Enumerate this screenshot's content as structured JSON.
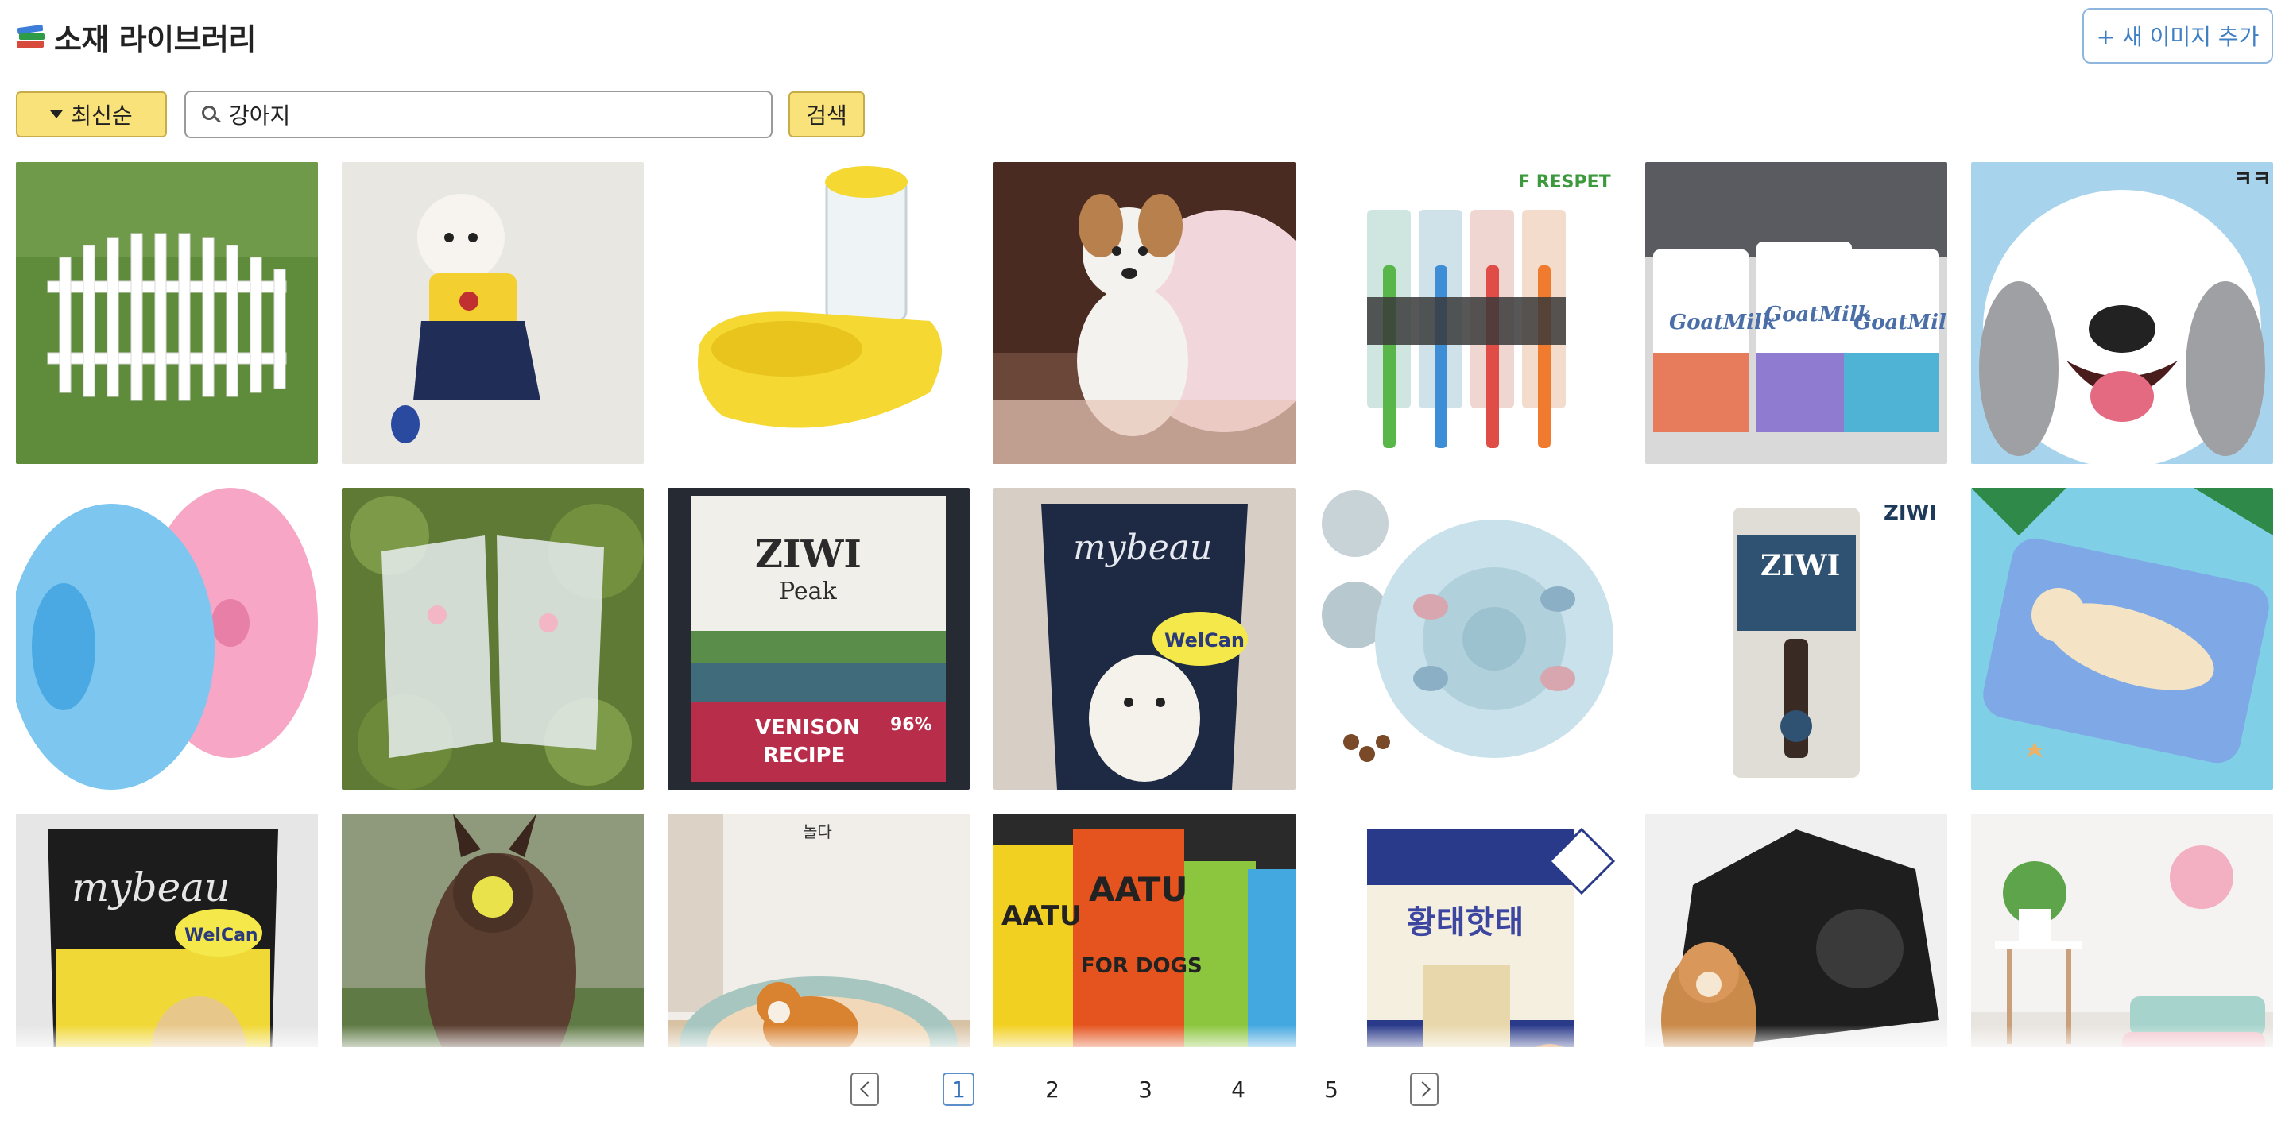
{
  "header": {
    "title": "소재 라이브러리",
    "add_button": "+ 새 이미지 추가"
  },
  "toolbar": {
    "sort_label": "최신순",
    "search_value": "강아지",
    "search_button": "검색"
  },
  "tiles": [
    {
      "name": "fence",
      "selected": false
    },
    {
      "name": "dog-dress",
      "selected": false
    },
    {
      "name": "water-dispenser",
      "selected": false
    },
    {
      "name": "puppy",
      "selected": true
    },
    {
      "name": "toothbrush-set",
      "selected": false
    },
    {
      "name": "goat-milk-packs",
      "selected": false
    },
    {
      "name": "dog-illustration",
      "selected": false
    },
    {
      "name": "donut-balls",
      "selected": false
    },
    {
      "name": "lace-clothes",
      "selected": false
    },
    {
      "name": "ziwi-peak-bag",
      "selected": false
    },
    {
      "name": "mybeau-pouch",
      "selected": false
    },
    {
      "name": "puzzle-feeder",
      "selected": false
    },
    {
      "name": "ziwi-chew",
      "selected": false
    },
    {
      "name": "cooling-mat",
      "selected": false
    },
    {
      "name": "mybeau-pack",
      "selected": false
    },
    {
      "name": "running-dog",
      "selected": false
    },
    {
      "name": "dog-bed",
      "selected": false
    },
    {
      "name": "aatu-food-bags",
      "selected": false
    },
    {
      "name": "pollack-treats",
      "selected": false
    },
    {
      "name": "pet-tent",
      "selected": false
    },
    {
      "name": "pet-cushions",
      "selected": false
    }
  ],
  "tile_text": {
    "forespet": "F  RESPET",
    "goat1": "GoatMilk",
    "goat2": "GoatMilk",
    "goat3": "GoatMilk",
    "kkk": "ㅋㅋ",
    "ziwi_peak": "ZIWI",
    "peak": "Peak",
    "venison": "VENISON",
    "recipe": "RECIPE",
    "pct": "96%",
    "mybeau": "mybeau",
    "welcan": "WelCan",
    "ziwi_logo": "ZIWI",
    "ziwi_chew": "ZIWI",
    "mybeau2": "mybeau",
    "welcan2": "WelCan",
    "nolda": "놀다",
    "aatu1": "AATU",
    "aatu2": "AATU",
    "fordogs": "FOR DOGS",
    "treat_name": "황태핫태"
  },
  "pagination": {
    "pages": [
      "1",
      "2",
      "3",
      "4",
      "5"
    ],
    "current": "1"
  },
  "colors": {
    "accent_yellow": "#fae27a",
    "selected_outline": "#5ac8d8",
    "link_blue": "#3f7fc4"
  }
}
